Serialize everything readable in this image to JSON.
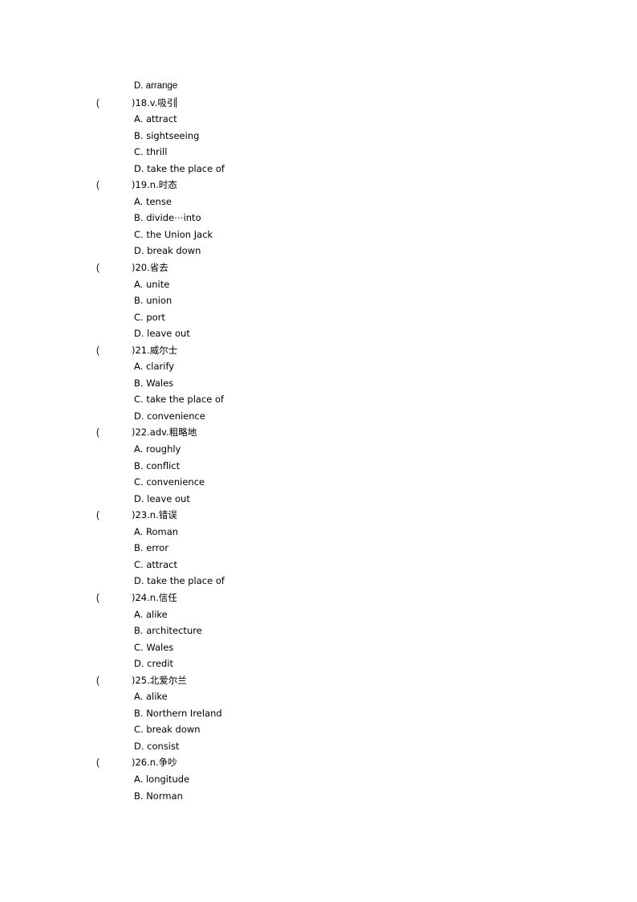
{
  "document": {
    "page_background": "#ffffff",
    "text_color": "#000000",
    "orphan_option_top": "D. arrange",
    "caret_after_question": "18"
  },
  "questions": [
    {
      "number": "18",
      "prompt": "(        )18.v.吸引",
      "paren_open": "(",
      "stem": ")18.v.吸引",
      "options": [
        "A. attract",
        "B. sightseeing",
        "C. thrill",
        "D. take the place of"
      ]
    },
    {
      "number": "19",
      "prompt": "(        )19.n.时态",
      "paren_open": "(",
      "stem": ")19.n.时态",
      "options": [
        "A. tense",
        "B. divide⋯into",
        "C. the Union Jack",
        "D. break down"
      ]
    },
    {
      "number": "20",
      "prompt": "(        )20.省去",
      "paren_open": "(",
      "stem": ")20.省去",
      "options": [
        "A. unite",
        "B. union",
        "C. port",
        "D. leave out"
      ]
    },
    {
      "number": "21",
      "prompt": "(        )21.威尔士",
      "paren_open": "(",
      "stem": ")21.威尔士",
      "options": [
        "A. clarify",
        "B. Wales",
        "C. take the place of",
        "D. convenience"
      ]
    },
    {
      "number": "22",
      "prompt": "(        )22.adv.粗略地",
      "paren_open": "(",
      "stem": ")22.adv.粗略地",
      "options": [
        "A. roughly",
        "B. conflict",
        "C. convenience",
        "D. leave out"
      ]
    },
    {
      "number": "23",
      "prompt": "(        )23.n.错误",
      "paren_open": "(",
      "stem": ")23.n.错误",
      "options": [
        "A. Roman",
        "B. error",
        "C. attract",
        "D. take the place of"
      ]
    },
    {
      "number": "24",
      "prompt": "(        )24.n.信任",
      "paren_open": "(",
      "stem": ")24.n.信任",
      "options": [
        "A. alike",
        "B. architecture",
        "C. Wales",
        "D. credit"
      ]
    },
    {
      "number": "25",
      "prompt": "(        )25.北爱尔兰",
      "paren_open": "(",
      "stem": ")25.北爱尔兰",
      "options": [
        "A. alike",
        "B. Northern Ireland",
        "C. break down",
        "D. consist"
      ]
    },
    {
      "number": "26",
      "prompt": "(        )26.n.争吵",
      "paren_open": "(",
      "stem": ")26.n.争吵",
      "options": [
        "A. longitude",
        "B. Norman"
      ]
    }
  ]
}
